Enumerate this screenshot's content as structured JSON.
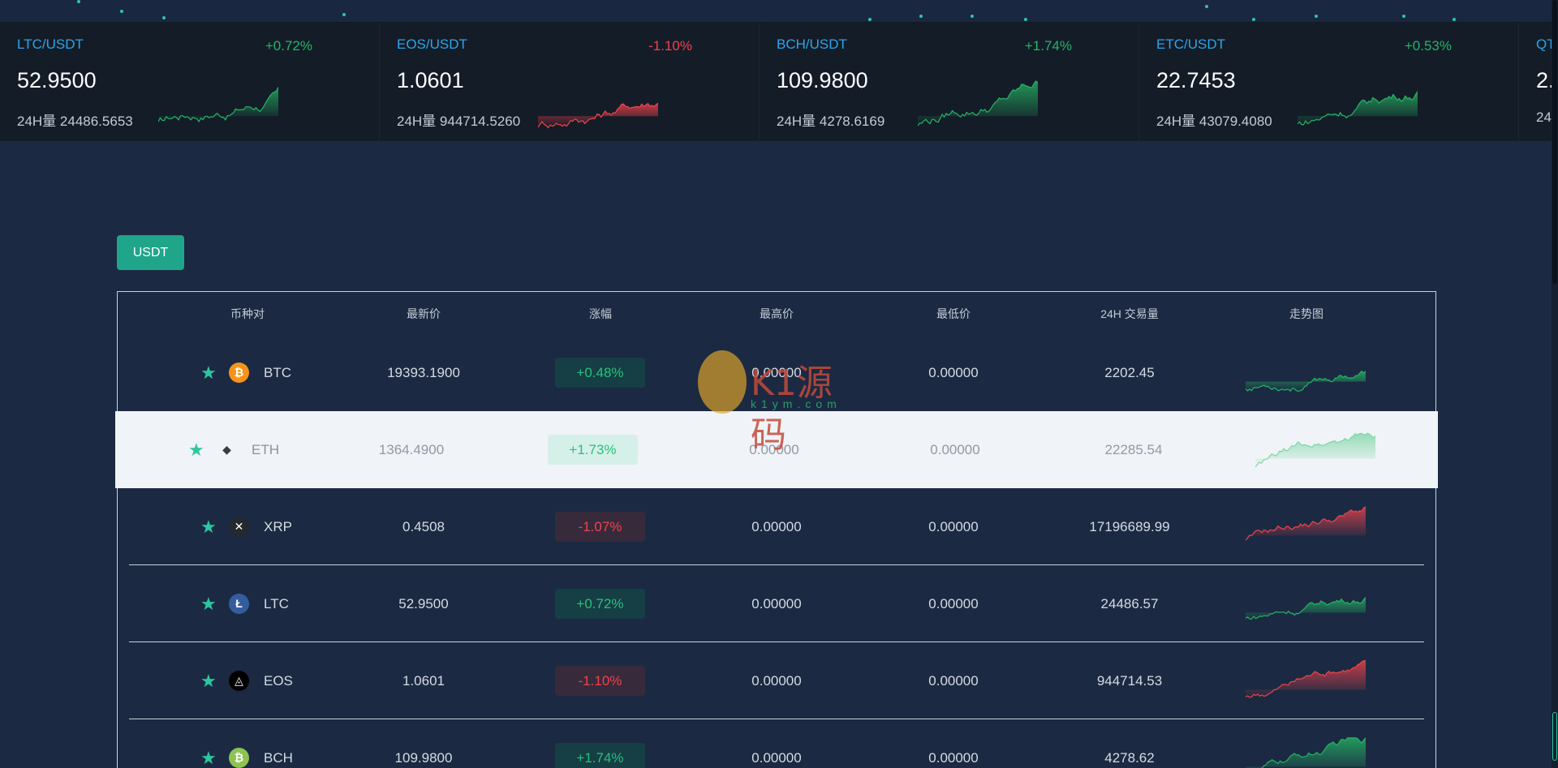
{
  "ticker": [
    {
      "pair": "LTC/USDT",
      "change": "+0.72%",
      "dir": "up",
      "price": "52.9500",
      "volume": "24H量 24486.5653"
    },
    {
      "pair": "EOS/USDT",
      "change": "-1.10%",
      "dir": "down",
      "price": "1.0601",
      "volume": "24H量 944714.5260"
    },
    {
      "pair": "BCH/USDT",
      "change": "+1.74%",
      "dir": "up",
      "price": "109.9800",
      "volume": "24H量 4278.6169"
    },
    {
      "pair": "ETC/USDT",
      "change": "+0.53%",
      "dir": "up",
      "price": "22.7453",
      "volume": "24H量 43079.4080"
    },
    {
      "pair": "QT",
      "change": "",
      "dir": "up",
      "price": "2.",
      "volume": "24"
    }
  ],
  "tabs": {
    "active_label": "USDT"
  },
  "table": {
    "headers": [
      "币种对",
      "最新价",
      "涨幅",
      "最高价",
      "最低价",
      "24H 交易量",
      "走势图"
    ],
    "rows": [
      {
        "symbol": "BTC",
        "icon": "bitcoin-icon",
        "icon_color": "#f7931a",
        "icon_glyph": "₿",
        "price": "19393.1900",
        "change": "+0.48%",
        "dir": "up",
        "high": "0.00000",
        "low": "0.00000",
        "volume": "2202.45"
      },
      {
        "symbol": "ETH",
        "icon": "ethereum-icon",
        "icon_color": "#f0f3f7",
        "icon_glyph": "◆",
        "price": "1364.4900",
        "change": "+1.73%",
        "dir": "up",
        "high": "0.00000",
        "low": "0.00000",
        "volume": "22285.54"
      },
      {
        "symbol": "XRP",
        "icon": "ripple-icon",
        "icon_color": "#23292f",
        "icon_glyph": "✕",
        "price": "0.4508",
        "change": "-1.07%",
        "dir": "down",
        "high": "0.00000",
        "low": "0.00000",
        "volume": "17196689.99"
      },
      {
        "symbol": "LTC",
        "icon": "litecoin-icon",
        "icon_color": "#345d9d",
        "icon_glyph": "Ł",
        "price": "52.9500",
        "change": "+0.72%",
        "dir": "up",
        "high": "0.00000",
        "low": "0.00000",
        "volume": "24486.57"
      },
      {
        "symbol": "EOS",
        "icon": "eos-icon",
        "icon_color": "#000000",
        "icon_glyph": "◬",
        "price": "1.0601",
        "change": "-1.10%",
        "dir": "down",
        "high": "0.00000",
        "low": "0.00000",
        "volume": "944714.53"
      },
      {
        "symbol": "BCH",
        "icon": "bitcoin-cash-icon",
        "icon_color": "#8dc351",
        "icon_glyph": "₿",
        "price": "109.9800",
        "change": "+1.74%",
        "dir": "up",
        "high": "0.00000",
        "low": "0.00000",
        "volume": "4278.62"
      }
    ]
  },
  "watermark": {
    "text": "K1源码",
    "sub": "k1ym.com"
  },
  "colors": {
    "up": "#25b564",
    "down": "#f0434c",
    "accent": "#1fa58a"
  }
}
